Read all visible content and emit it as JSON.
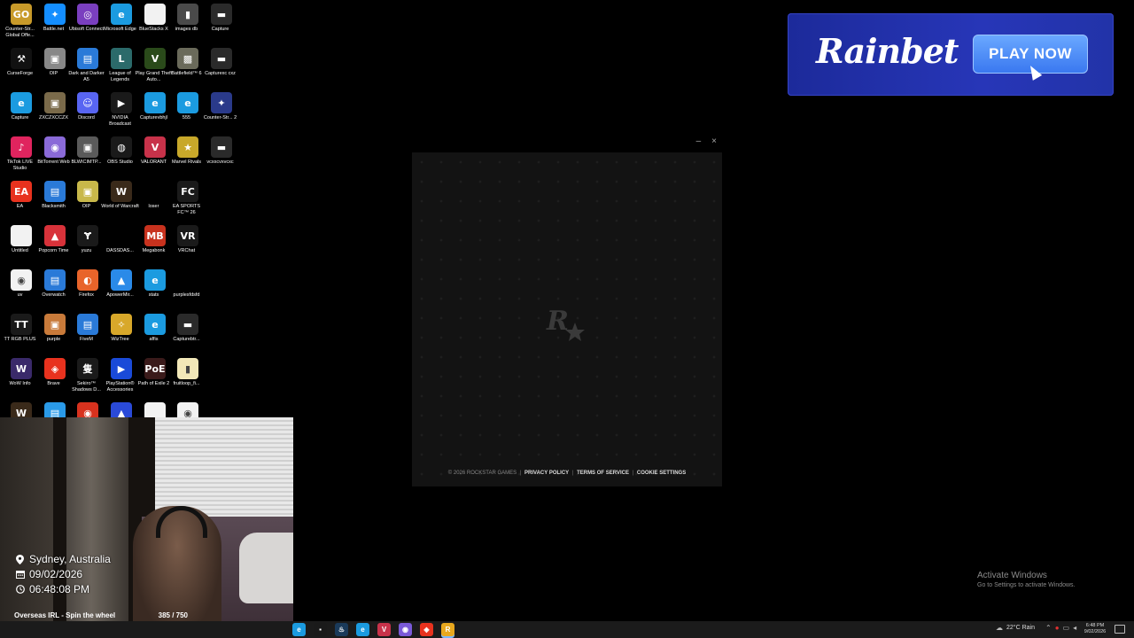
{
  "desktop_icons": [
    {
      "label": "Counter-Str... Global Offe...",
      "icon": "csgo-icon",
      "color": "#c89a2a",
      "glyph": "GO"
    },
    {
      "label": "Battle.net",
      "icon": "battlenet-icon",
      "color": "#148eff",
      "glyph": "✦"
    },
    {
      "label": "Ubisoft Connect",
      "icon": "ubisoft-icon",
      "color": "#7a3fbf",
      "glyph": "◎"
    },
    {
      "label": "Microsoft Edge",
      "icon": "edge-icon",
      "color": "#1b9be0",
      "glyph": "e"
    },
    {
      "label": "BlueStacks X",
      "icon": "file-icon",
      "color": "#f2f2f2",
      "glyph": ""
    },
    {
      "label": "images db",
      "icon": "images-db-icon",
      "color": "#4a4a4a",
      "glyph": "▮"
    },
    {
      "label": "Capture",
      "icon": "capture-icon",
      "color": "#2a2a2a",
      "glyph": "▬"
    },
    {
      "label": "CurseForge",
      "icon": "curseforge-icon",
      "color": "#111111",
      "glyph": "⚒"
    },
    {
      "label": "OIP",
      "icon": "image-icon",
      "color": "#888888",
      "glyph": "▣"
    },
    {
      "label": "Dark and Darker A5",
      "icon": "doc-icon",
      "color": "#2a7ad8",
      "glyph": "▤"
    },
    {
      "label": "League of Legends",
      "icon": "lol-icon",
      "color": "#2b6a6a",
      "glyph": "L"
    },
    {
      "label": "Play Grand Theft Auto...",
      "icon": "gta-icon",
      "color": "#2a4a1a",
      "glyph": "V"
    },
    {
      "label": "Battlefield™ 6",
      "icon": "battlefield-icon",
      "color": "#6a6a5a",
      "glyph": "▩"
    },
    {
      "label": "Capturexc cxz",
      "icon": "capture-icon",
      "color": "#2a2a2a",
      "glyph": "▬"
    },
    {
      "label": "Capture",
      "icon": "edge-icon",
      "color": "#1b9be0",
      "glyph": "e"
    },
    {
      "label": "ZXCZXCCZX",
      "icon": "image-icon",
      "color": "#7a6a4a",
      "glyph": "▣"
    },
    {
      "label": "Discord",
      "icon": "discord-icon",
      "color": "#5865f2",
      "glyph": "☺"
    },
    {
      "label": "NVIDIA Broadcast",
      "icon": "nvidia-icon",
      "color": "#1a1a1a",
      "glyph": "▶"
    },
    {
      "label": "Capturevbhjl",
      "icon": "edge-icon",
      "color": "#1b9be0",
      "glyph": "e"
    },
    {
      "label": "555",
      "icon": "edge-icon",
      "color": "#1b9be0",
      "glyph": "e"
    },
    {
      "label": "Counter-Str... 2",
      "icon": "cs2-icon",
      "color": "#2a3a8a",
      "glyph": "✦"
    },
    {
      "label": "TikTok LIVE Studio",
      "icon": "tiktok-icon",
      "color": "#e0245e",
      "glyph": "♪"
    },
    {
      "label": "BitTorrent Web",
      "icon": "bittorrent-icon",
      "color": "#8a6ad8",
      "glyph": "◉"
    },
    {
      "label": "BLWICIMTP...",
      "icon": "image-icon",
      "color": "#5a5a5a",
      "glyph": "▣"
    },
    {
      "label": "OBS Studio",
      "icon": "obs-icon",
      "color": "#1a1a1a",
      "glyph": "◍"
    },
    {
      "label": "VALORANT",
      "icon": "valorant-icon",
      "color": "#c8324a",
      "glyph": "V"
    },
    {
      "label": "Marvel Rivals",
      "icon": "marvel-rivals-icon",
      "color": "#c8a82a",
      "glyph": "★"
    },
    {
      "label": "vcxxcvxvcxc",
      "icon": "capture-icon",
      "color": "#2a2a2a",
      "glyph": "▬"
    },
    {
      "label": "EA",
      "icon": "ea-icon",
      "color": "#e8321e",
      "glyph": "EA"
    },
    {
      "label": "Blacksmith",
      "icon": "doc-icon",
      "color": "#2a7ad8",
      "glyph": "▤"
    },
    {
      "label": "OIP",
      "icon": "image-icon",
      "color": "#c8b84a",
      "glyph": "▣"
    },
    {
      "label": "World of Warcraft",
      "icon": "wow-icon",
      "color": "#3a2a1a",
      "glyph": "W"
    },
    {
      "label": "loser",
      "icon": "blank-icon",
      "color": "#000000",
      "glyph": ""
    },
    {
      "label": "EA SPORTS FC™ 26",
      "icon": "eafc-icon",
      "color": "#1a1a1a",
      "glyph": "FC"
    },
    {
      "label": "Untitled",
      "icon": "file-icon",
      "color": "#f2f2f2",
      "glyph": ""
    },
    {
      "label": "Popcorn Time",
      "icon": "popcorn-icon",
      "color": "#d8323a",
      "glyph": "▲"
    },
    {
      "label": "yuzu",
      "icon": "yuzu-icon",
      "color": "#1a1a1a",
      "glyph": "Ɏ"
    },
    {
      "label": "DASSDAS...",
      "icon": "blank-icon",
      "color": "#000000",
      "glyph": ""
    },
    {
      "label": "Megabonk",
      "icon": "megabonk-icon",
      "color": "#c8321e",
      "glyph": "MB"
    },
    {
      "label": "VRChat",
      "icon": "vrchat-icon",
      "color": "#1a1a1a",
      "glyph": "VR"
    },
    {
      "label": "uv",
      "icon": "chrome-icon",
      "color": "#f2f2f2",
      "glyph": "◉"
    },
    {
      "label": "Overwatch",
      "icon": "doc-icon",
      "color": "#2a7ad8",
      "glyph": "▤"
    },
    {
      "label": "Firefox",
      "icon": "firefox-icon",
      "color": "#e8642a",
      "glyph": "◐"
    },
    {
      "label": "ApowerMir...",
      "icon": "apowermirror-icon",
      "color": "#2a8ae8",
      "glyph": "▲"
    },
    {
      "label": "stats",
      "icon": "edge-icon",
      "color": "#1b9be0",
      "glyph": "e"
    },
    {
      "label": "purplesfdsfd",
      "icon": "blank-icon",
      "color": "#000000",
      "glyph": ""
    },
    {
      "label": "TT RGB PLUS",
      "icon": "ttrgb-icon",
      "color": "#1a1a1a",
      "glyph": "TT"
    },
    {
      "label": "purple",
      "icon": "image-icon",
      "color": "#c87a3a",
      "glyph": "▣"
    },
    {
      "label": "FiveM",
      "icon": "doc-icon",
      "color": "#2a7ad8",
      "glyph": "▤"
    },
    {
      "label": "WizTree",
      "icon": "wiztree-icon",
      "color": "#d8a82a",
      "glyph": "✧"
    },
    {
      "label": "affis",
      "icon": "edge-icon",
      "color": "#1b9be0",
      "glyph": "e"
    },
    {
      "label": "Capturebtr...",
      "icon": "capture-icon",
      "color": "#2a2a2a",
      "glyph": "▬"
    },
    {
      "label": "WoW Info",
      "icon": "wow-info-icon",
      "color": "#3a2a6a",
      "glyph": "W"
    },
    {
      "label": "Brave",
      "icon": "brave-icon",
      "color": "#e8321e",
      "glyph": "◈"
    },
    {
      "label": "Sekiro™ Shadows D...",
      "icon": "sekiro-icon",
      "color": "#1a1a1a",
      "glyph": "隻"
    },
    {
      "label": "PlayStation® Accessories",
      "icon": "playstation-icon",
      "color": "#1a4ad8",
      "glyph": "▶"
    },
    {
      "label": "Path of Exile 2",
      "icon": "poe-icon",
      "color": "#3a1a1a",
      "glyph": "PoE"
    },
    {
      "label": "fruitloop_fi...",
      "icon": "file-icon",
      "color": "#f2e8b8",
      "glyph": "▮"
    },
    {
      "label": "",
      "icon": "wow-icon",
      "color": "#3a2a1a",
      "glyph": "W"
    },
    {
      "label": "",
      "icon": "doc-icon",
      "color": "#2a9ae8",
      "glyph": "▤"
    },
    {
      "label": "",
      "icon": "chrome-icon",
      "color": "#d8321e",
      "glyph": "◉"
    },
    {
      "label": "",
      "icon": "app-icon",
      "color": "#2a4ad8",
      "glyph": "▲"
    },
    {
      "label": "",
      "icon": "file-icon",
      "color": "#f2f2f2",
      "glyph": ""
    },
    {
      "label": "",
      "icon": "chrome-icon",
      "color": "#f2f2f2",
      "glyph": "◉"
    }
  ],
  "ad": {
    "brand": "Rainbet",
    "cta": "PLAY NOW"
  },
  "launcher": {
    "minimize": "–",
    "close": "×",
    "copyright": "© 2026 ROCKSTAR GAMES",
    "links": [
      "PRIVACY POLICY",
      "TERMS OF SERVICE",
      "COOKIE SETTINGS"
    ]
  },
  "stream_overlay": {
    "location": "Sydney, Australia",
    "date": "09/02/2026",
    "time": "06:48:08 PM",
    "goal_title": "Overseas IRL - Spin the wheel",
    "goal_count": "385 / 750",
    "goal_progress": 0.513
  },
  "activation": {
    "title": "Activate Windows",
    "subtitle": "Go to Settings to activate Windows."
  },
  "taskbar": {
    "apps": [
      {
        "icon": "edge-icon",
        "color": "#1b9be0",
        "glyph": "e"
      },
      {
        "icon": "file-icon",
        "color": "#1a1a1a",
        "glyph": "▪"
      },
      {
        "icon": "steam-icon",
        "color": "#1a3a5a",
        "glyph": "♨"
      },
      {
        "icon": "edge-icon",
        "color": "#1b9be0",
        "glyph": "e"
      },
      {
        "icon": "valorant-icon",
        "color": "#c8324a",
        "glyph": "V"
      },
      {
        "icon": "chrome-icon",
        "color": "#7a5ad8",
        "glyph": "◉"
      },
      {
        "icon": "brave-icon",
        "color": "#e8321e",
        "glyph": "◈"
      },
      {
        "icon": "rockstar-icon",
        "color": "#e8a81e",
        "glyph": "R"
      }
    ],
    "weather": "22°C  Rain",
    "clock_time": "6:48 PM",
    "clock_date": "9/02/2026"
  }
}
